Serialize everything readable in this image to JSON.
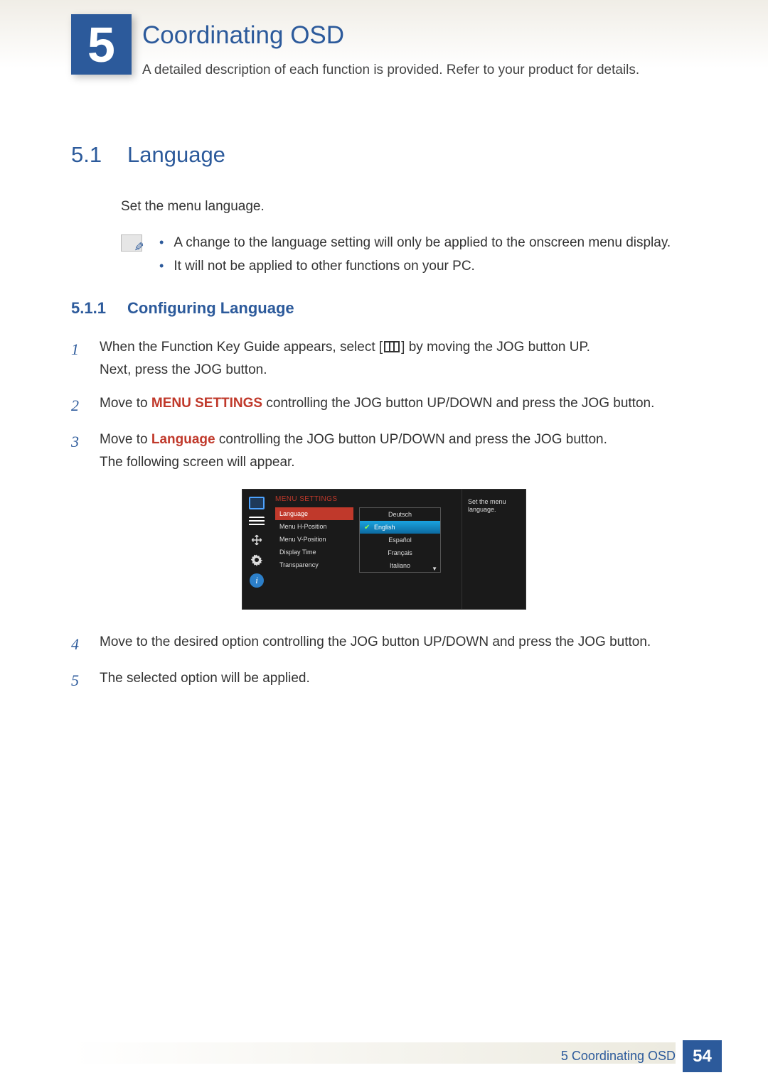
{
  "chapter": {
    "number": "5",
    "title": "Coordinating OSD",
    "subtitle": "A detailed description of each function is provided. Refer to your product for details."
  },
  "section_5_1": {
    "number": "5.1",
    "title": "Language",
    "lead": "Set the menu language.",
    "notes": [
      "A change to the language setting will only be applied to the onscreen menu display.",
      "It will not be applied to other functions on your PC."
    ],
    "subsection": {
      "number": "5.1.1",
      "title": "Configuring Language",
      "steps": {
        "s1a": "When the Function Key Guide appears, select [",
        "s1b": "] by moving the JOG button UP.",
        "s1c": "Next, press the JOG button.",
        "s2a": "Move to ",
        "s2kw": "MENU SETTINGS",
        "s2b": " controlling the JOG button UP/DOWN and press the JOG button.",
        "s3a": "Move to ",
        "s3kw": "Language",
        "s3b": " controlling the JOG button UP/DOWN and press the JOG button.",
        "s3c": "The following screen will appear.",
        "s4": "Move to the desired option controlling the JOG button UP/DOWN and press the JOG button.",
        "s5": "The selected option will be applied."
      }
    }
  },
  "osd": {
    "heading": "MENU SETTINGS",
    "menu_items": [
      {
        "label": "Language",
        "selected": true
      },
      {
        "label": "Menu H-Position",
        "selected": false
      },
      {
        "label": "Menu V-Position",
        "selected": false
      },
      {
        "label": "Display Time",
        "selected": false
      },
      {
        "label": "Transparency",
        "selected": false
      }
    ],
    "language_options": [
      {
        "label": "Deutsch",
        "selected": false
      },
      {
        "label": "English",
        "selected": true
      },
      {
        "label": "Español",
        "selected": false
      },
      {
        "label": "Français",
        "selected": false
      },
      {
        "label": "Italiano",
        "selected": false
      }
    ],
    "help_text": "Set the menu language."
  },
  "footer": {
    "chapter_ref": "5 Coordinating OSD",
    "page": "54"
  }
}
